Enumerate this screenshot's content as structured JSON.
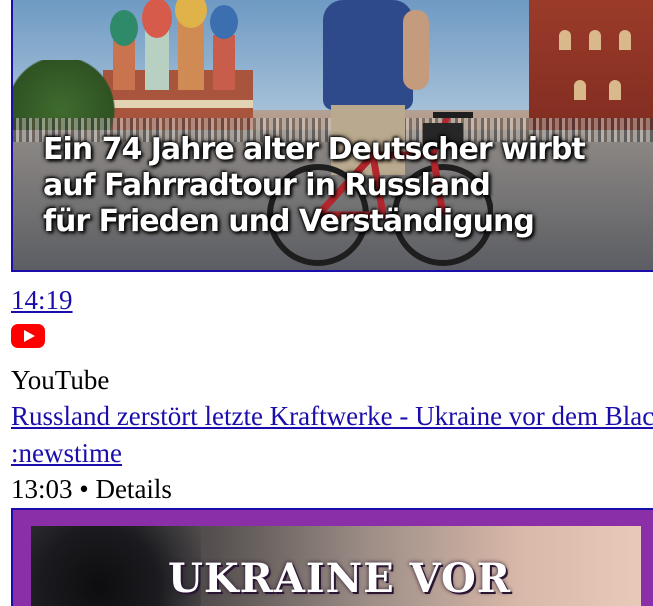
{
  "video1": {
    "thumbnail_headline_lines": [
      "Ein 74 Jahre alter Deutscher wirbt",
      "auf Fahrradtour in Russland",
      "für Frieden und Verständigung"
    ],
    "duration": "14:19",
    "platform_icon": "youtube-icon",
    "source": "YouTube"
  },
  "video2": {
    "title": "Russland zerstört letzte Kraftwerke - Ukraine vor dem Blackout",
    "channel": ":newstime",
    "meta": "13:03 • Details",
    "thumbnail_headline": "UKRAINE VOR"
  },
  "colors": {
    "link": "#1a0dab",
    "youtube_red": "#ff0000",
    "thumb2_frame": "#8b2fa8"
  }
}
